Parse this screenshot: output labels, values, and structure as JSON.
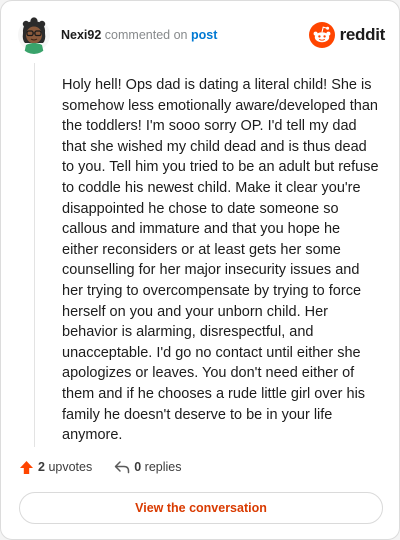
{
  "comment": {
    "username": "Nexi92",
    "action_text": "commented on",
    "post_link_label": "post",
    "body": "Holy hell! Ops dad is dating a literal child! She is somehow less emotionally aware/developed than the toddlers! I'm sooo sorry OP. I'd tell my dad that she wished my child dead and is thus dead to you. Tell him you tried to be an adult but refuse to coddle his newest child. Make it clear you're disappointed he chose to date someone so callous and immature and that you hope he either reconsiders or at least gets her some counselling for her major insecurity issues and her trying to overcompensate by trying to force herself on you and your unborn child. Her behavior is alarming, disrespectful, and unacceptable. I'd go no contact until either she apologizes or leaves. You don't need either of them and if he chooses a rude little girl over his family he doesn't deserve to be in your life anymore."
  },
  "brand": {
    "name": "reddit",
    "icon": "reddit-alien-icon",
    "color": "#ff4500"
  },
  "stats": {
    "upvotes_count": "2",
    "upvotes_label": "upvotes",
    "upvote_icon": "upvote-arrow-icon",
    "upvote_color": "#ff4500",
    "replies_count": "0",
    "replies_label": "replies",
    "reply_icon": "reply-arrow-icon"
  },
  "actions": {
    "view_conversation_label": "View the conversation",
    "accent_color": "#d93a00"
  }
}
